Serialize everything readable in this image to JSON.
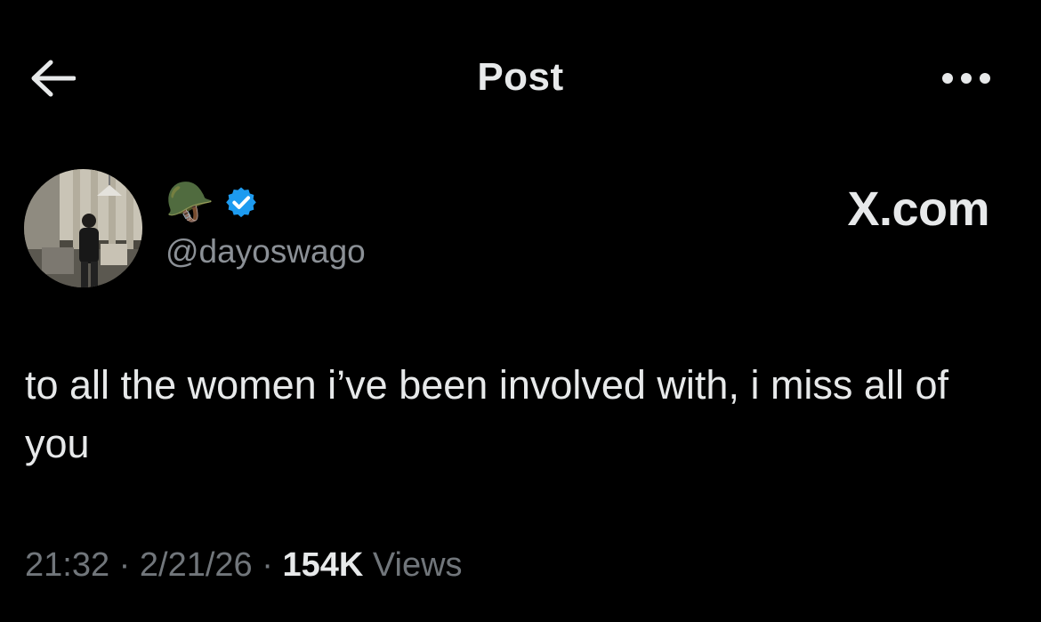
{
  "header": {
    "title": "Post",
    "back_icon": "arrow-left-icon",
    "more_icon": "more-horizontal-icon"
  },
  "author": {
    "display_name_emoji": "🪖",
    "verified_icon": "verified-badge-icon",
    "handle": "@dayoswago",
    "avatar": "profile-photo"
  },
  "watermark": "X.com",
  "post": {
    "text": "to all the women i’ve been involved with, i miss all of you",
    "time": "21:32",
    "date": "2/21/26",
    "views_count": "154K",
    "views_label": "Views",
    "separator": "·"
  },
  "colors": {
    "background": "#000000",
    "text_primary": "#e7e9ea",
    "text_secondary": "#71767b",
    "verified_blue": "#1d9bf0"
  }
}
